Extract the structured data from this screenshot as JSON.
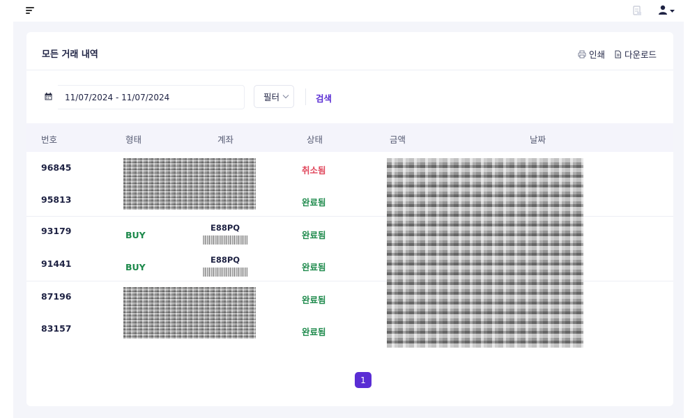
{
  "header": {
    "icons": {
      "menu": "hamburger-menu-icon",
      "document": "document-icon",
      "user": "user-icon"
    }
  },
  "card": {
    "title": "모든 거래 내역",
    "print_label": "인쇄",
    "download_label": "다운로드"
  },
  "filters": {
    "date_range": "11/07/2024 - 11/07/2024",
    "filter_label": "필터",
    "search_label": "검색"
  },
  "table": {
    "columns": [
      "번호",
      "형태",
      "계좌",
      "상태",
      "금액",
      "날짜"
    ],
    "rows": [
      {
        "id": "96845",
        "type": "",
        "account": "",
        "status": "취소됨"
      },
      {
        "id": "95813",
        "type": "",
        "account": "",
        "status": "완료됨"
      },
      {
        "id": "93179",
        "type": "BUY",
        "account": "E88PQ",
        "status": "완료됨"
      },
      {
        "id": "91441",
        "type": "BUY",
        "account": "E88PQ",
        "status": "완료됨"
      },
      {
        "id": "87196",
        "type": "",
        "account": "",
        "status": "완료됨"
      },
      {
        "id": "83157",
        "type": "",
        "account": "",
        "status": "완료됨"
      }
    ]
  },
  "pagination": {
    "current": "1"
  },
  "colors": {
    "accent": "#5a2dd4",
    "status_completed": "#1e8a4c",
    "status_cancelled": "#e0455a",
    "text_primary": "#1e2243"
  }
}
